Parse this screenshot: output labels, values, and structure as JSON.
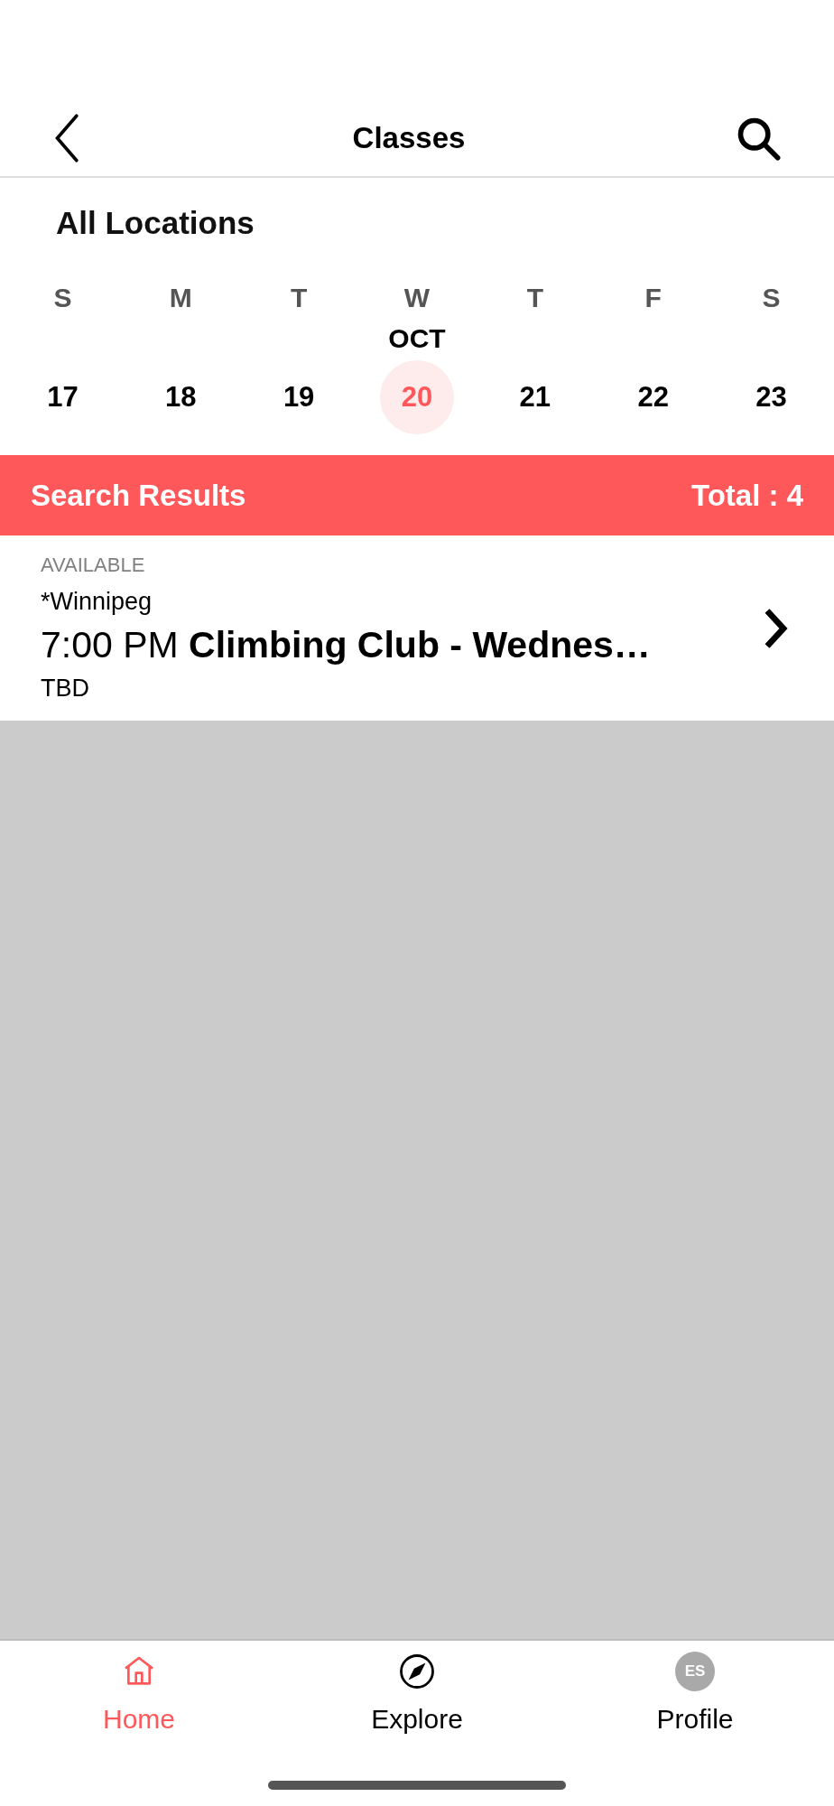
{
  "header": {
    "title": "Classes"
  },
  "location": "All Locations",
  "calendar": {
    "days": [
      {
        "letter": "S",
        "date": "17",
        "selected": false
      },
      {
        "letter": "M",
        "date": "18",
        "selected": false
      },
      {
        "letter": "T",
        "date": "19",
        "selected": false
      },
      {
        "letter": "W",
        "date": "20",
        "selected": true,
        "month": "OCT"
      },
      {
        "letter": "T",
        "date": "21",
        "selected": false
      },
      {
        "letter": "F",
        "date": "22",
        "selected": false
      },
      {
        "letter": "S",
        "date": "23",
        "selected": false
      }
    ]
  },
  "results_bar": {
    "title": "Search Results",
    "total": "Total : 4"
  },
  "results": [
    {
      "status": "AVAILABLE",
      "location": "*Winnipeg",
      "title": "7:00 PM **Climbing Club - Wednes…**",
      "instructor": "TBD"
    }
  ],
  "tab_bar": [
    {
      "kind": "home",
      "label": "Home",
      "selected": true
    },
    {
      "kind": "explore",
      "label": "Explore",
      "selected": false
    },
    {
      "kind": "profile",
      "label": "Profile",
      "selected": false,
      "initials": "ES"
    }
  ]
}
